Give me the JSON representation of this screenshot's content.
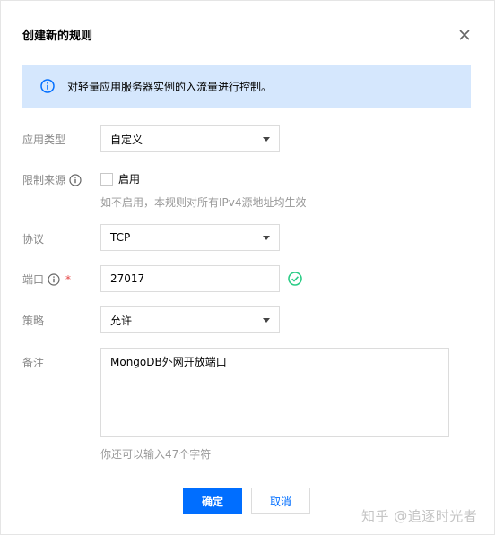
{
  "dialog": {
    "title": "创建新的规则",
    "notice": "对轻量应用服务器实例的入流量进行控制。"
  },
  "form": {
    "app_type": {
      "label": "应用类型",
      "value": "自定义"
    },
    "source_limit": {
      "label": "限制来源",
      "checkbox_label": "启用",
      "hint": "如不启用，本规则对所有IPv4源地址均生效"
    },
    "protocol": {
      "label": "协议",
      "value": "TCP"
    },
    "port": {
      "label": "端口",
      "required_mark": "*",
      "value": "27017"
    },
    "policy": {
      "label": "策略",
      "value": "允许"
    },
    "remark": {
      "label": "备注",
      "value": "MongoDB外网开放端口",
      "counter": "你还可以输入47个字符"
    }
  },
  "buttons": {
    "confirm": "确定",
    "cancel": "取消"
  },
  "watermark": "知乎 @追逐时光者",
  "colors": {
    "primary": "#006eff",
    "notice_bg": "#d5e7fd",
    "success": "#29cc85",
    "required": "#e54545"
  }
}
